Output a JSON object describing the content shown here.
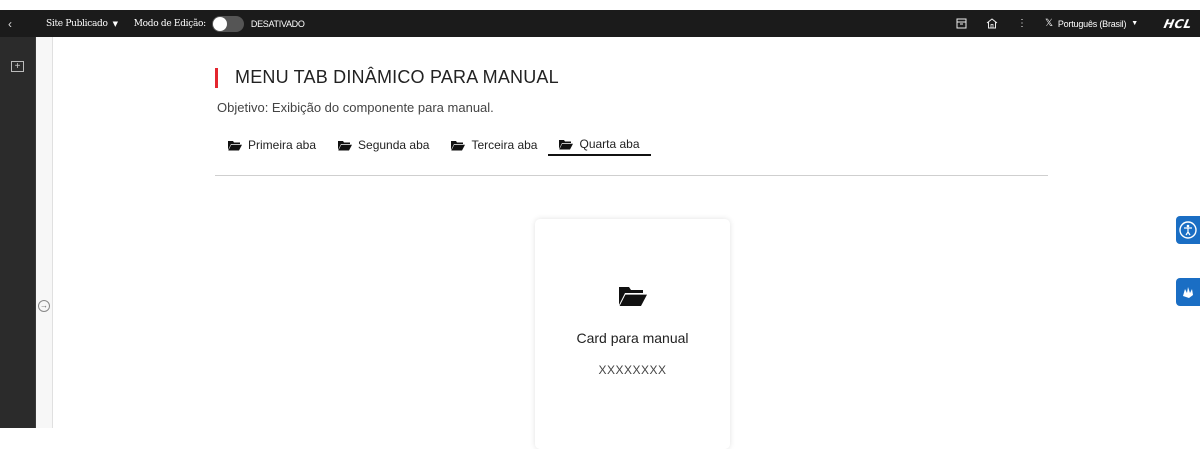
{
  "topbar": {
    "back_icon": "chevron-left-icon",
    "site_status": "Site Publicado",
    "edit_mode_label": "Modo de Edição:",
    "edit_mode_state": "DESATIVADO",
    "language": "Português (Brasil)",
    "logo": "HCL"
  },
  "page": {
    "title": "MENU TAB DINÂMICO PARA MANUAL",
    "objective": "Objetivo: Exibição do componente para manual.",
    "accent_color": "#e3262f"
  },
  "tabs": [
    {
      "label": "Primeira aba",
      "active": false
    },
    {
      "label": "Segunda aba",
      "active": false
    },
    {
      "label": "Terceira aba",
      "active": false
    },
    {
      "label": "Quarta aba",
      "active": true
    }
  ],
  "card": {
    "icon": "folder-open-icon",
    "title": "Card para manual",
    "subtitle": "XXXXXXXX"
  },
  "floating": {
    "accessibility_icon": "accessibility-icon",
    "sign_language_icon": "sign-language-icon",
    "color": "#1a6ec4"
  }
}
